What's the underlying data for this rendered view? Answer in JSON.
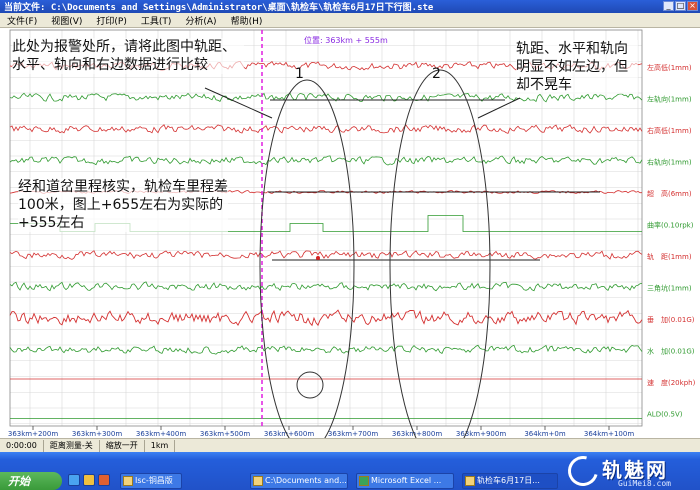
{
  "window": {
    "title": "当前文件: C:\\Documents and Settings\\Administrator\\桌面\\轨检车\\轨检车6月17日下行图.ste",
    "buttons": [
      "_",
      "□",
      "×"
    ]
  },
  "menu": [
    {
      "label": "文件(F)"
    },
    {
      "label": "视图(V)"
    },
    {
      "label": "打印(P)"
    },
    {
      "label": "工具(T)"
    },
    {
      "label": "分析(A)"
    },
    {
      "label": "帮助(H)"
    }
  ],
  "chart": {
    "position_label": "位置: 363km + 555m",
    "channels": [
      {
        "label": "左高低(1mm)",
        "color": "#d43030"
      },
      {
        "label": "左轨向(1mm)",
        "color": "#2f9a2f"
      },
      {
        "label": "右高低(1mm)",
        "color": "#d43030"
      },
      {
        "label": "右轨向(1mm)",
        "color": "#2f9a2f"
      },
      {
        "label": "超　高(6mm)",
        "color": "#d43030"
      },
      {
        "label": "曲率(0.10rpk)",
        "color": "#2f9a2f"
      },
      {
        "label": "轨　距(1mm)",
        "color": "#d43030"
      },
      {
        "label": "三角坑(1mm)",
        "color": "#2f9a2f"
      },
      {
        "label": "垂　加(0.01G)",
        "color": "#d43030"
      },
      {
        "label": "水　加(0.01G)",
        "color": "#2f9a2f"
      },
      {
        "label": "速　度(20kph)",
        "color": "#d43030"
      },
      {
        "label": "ALD(0.5V)",
        "color": "#2f9a2f"
      }
    ],
    "x_ticks": [
      "363km+200m",
      "363km+300m",
      "363km+400m",
      "363km+500m",
      "363km+600m",
      "363km+700m",
      "363km+800m",
      "363km+900m",
      "364km+0m",
      "364km+100m"
    ],
    "annotations": {
      "note_left_top": "此处为报警处所，请将此图中轨距、水平、轨向和右边数据进行比较",
      "note_left_mid": "经和道岔里程核实，轨检车里程差100米，图上+655左右为实际的+555左右",
      "note_right_top": "轨距、水平和轨向明显不如左边，但却不晃车",
      "ellipse1_label": "1",
      "ellipse2_label": "2"
    }
  },
  "status": [
    "0:00:00",
    "距离测量-关",
    "缩放一开",
    "1km"
  ],
  "taskbar": {
    "start": "开始",
    "tasks": [
      "Isc-铜昌版",
      "C:\\Documents and...",
      "Microsoft Excel ...",
      "轨检车6月17日..."
    ],
    "logo_text": "轨魅网",
    "logo_url": "GuiMei8.com"
  }
}
